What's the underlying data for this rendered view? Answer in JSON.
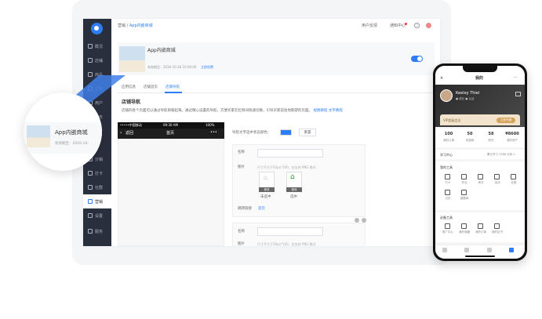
{
  "breadcrumb": {
    "parent": "营销",
    "separator": "/",
    "current": "App内嵌商城"
  },
  "topbar": {
    "customer_service": "用户反馈",
    "notifications": "通知中心",
    "help": "?"
  },
  "sidebar": {
    "items": [
      {
        "label": "概况",
        "icon": "home-icon"
      },
      {
        "label": "店铺",
        "icon": "store-icon"
      },
      {
        "label": "商品",
        "icon": "goods-icon"
      },
      {
        "label": "订单",
        "icon": "order-icon"
      },
      {
        "label": "用户",
        "icon": "user-icon"
      },
      {
        "label": "财务",
        "icon": "finance-icon"
      },
      {
        "label": "资产",
        "icon": "asset-icon"
      },
      {
        "label": "",
        "icon": "blank-icon"
      },
      {
        "label": "分销",
        "icon": "share-icon"
      },
      {
        "label": "打卡",
        "icon": "checkin-icon"
      },
      {
        "label": "社群",
        "icon": "community-icon"
      },
      {
        "label": "营销",
        "icon": "marketing-icon"
      },
      {
        "label": "设置",
        "icon": "settings-icon"
      },
      {
        "label": "服务",
        "icon": "service-icon"
      }
    ]
  },
  "app_card": {
    "title": "App内嵌商城",
    "meta": "有效期至：2016-10-28 10:00:00",
    "link": "立即续费",
    "toggle_on": true
  },
  "tabs": [
    {
      "label": "应用信息",
      "active": false
    },
    {
      "label": "店铺首页",
      "active": false
    },
    {
      "label": "店铺导航",
      "active": true
    }
  ],
  "section": {
    "title": "店铺导航",
    "desc": "店铺的各个页面可以通过导航串联起来。通过精心设置的导航，方便买家在栏目间快速切换，引导买家前往你期望的页面。",
    "link1": "视频教程",
    "link2": "文字教程"
  },
  "preview": {
    "signal": "•••••中国移动",
    "time": "09:30 AM",
    "battery": "100%",
    "back": "返回",
    "title": "首页",
    "more": "•••"
  },
  "form": {
    "selected_color_label": "导航文字选中状态颜色：",
    "reset": "重置",
    "name_label": "名称",
    "image_label": "图片",
    "image_hint": "尺寸不大于50px*100，仅支持 PNG 格式",
    "unselected": "未选中",
    "selected": "选中",
    "change": "修改",
    "link_label": "跳转链接",
    "link_value": "首页",
    "accent": "#2d7df6"
  },
  "magnifier": {
    "title": "App内嵌商城",
    "meta": "有效期至：2016-10-"
  },
  "mobile": {
    "title": "我的",
    "close": "✕",
    "more": "···",
    "user_name": "Keeley Thiel",
    "user_tag": "● 成长 ● 认证",
    "vip": "VIP超级会员",
    "vip_btn": "立即开通",
    "stats": [
      {
        "v": "100",
        "l": "我的订单"
      },
      {
        "v": "50",
        "l": "优惠券"
      },
      {
        "v": "58",
        "l": "积分"
      },
      {
        "v": "¥8600",
        "l": "我的资产"
      }
    ],
    "learn": "学习中心",
    "learn_more": "累计学习 1568 分钟 >",
    "tools_title": "我的工具",
    "tools": [
      "打卡",
      "作业",
      "考试",
      "活动",
      "社群",
      "日历",
      "做题单"
    ],
    "tools2_title": "必备工具",
    "tools2": [
      "推广中心",
      "我的收藏",
      "我的订单",
      "我的证书"
    ],
    "accent": "#d4a45b"
  }
}
